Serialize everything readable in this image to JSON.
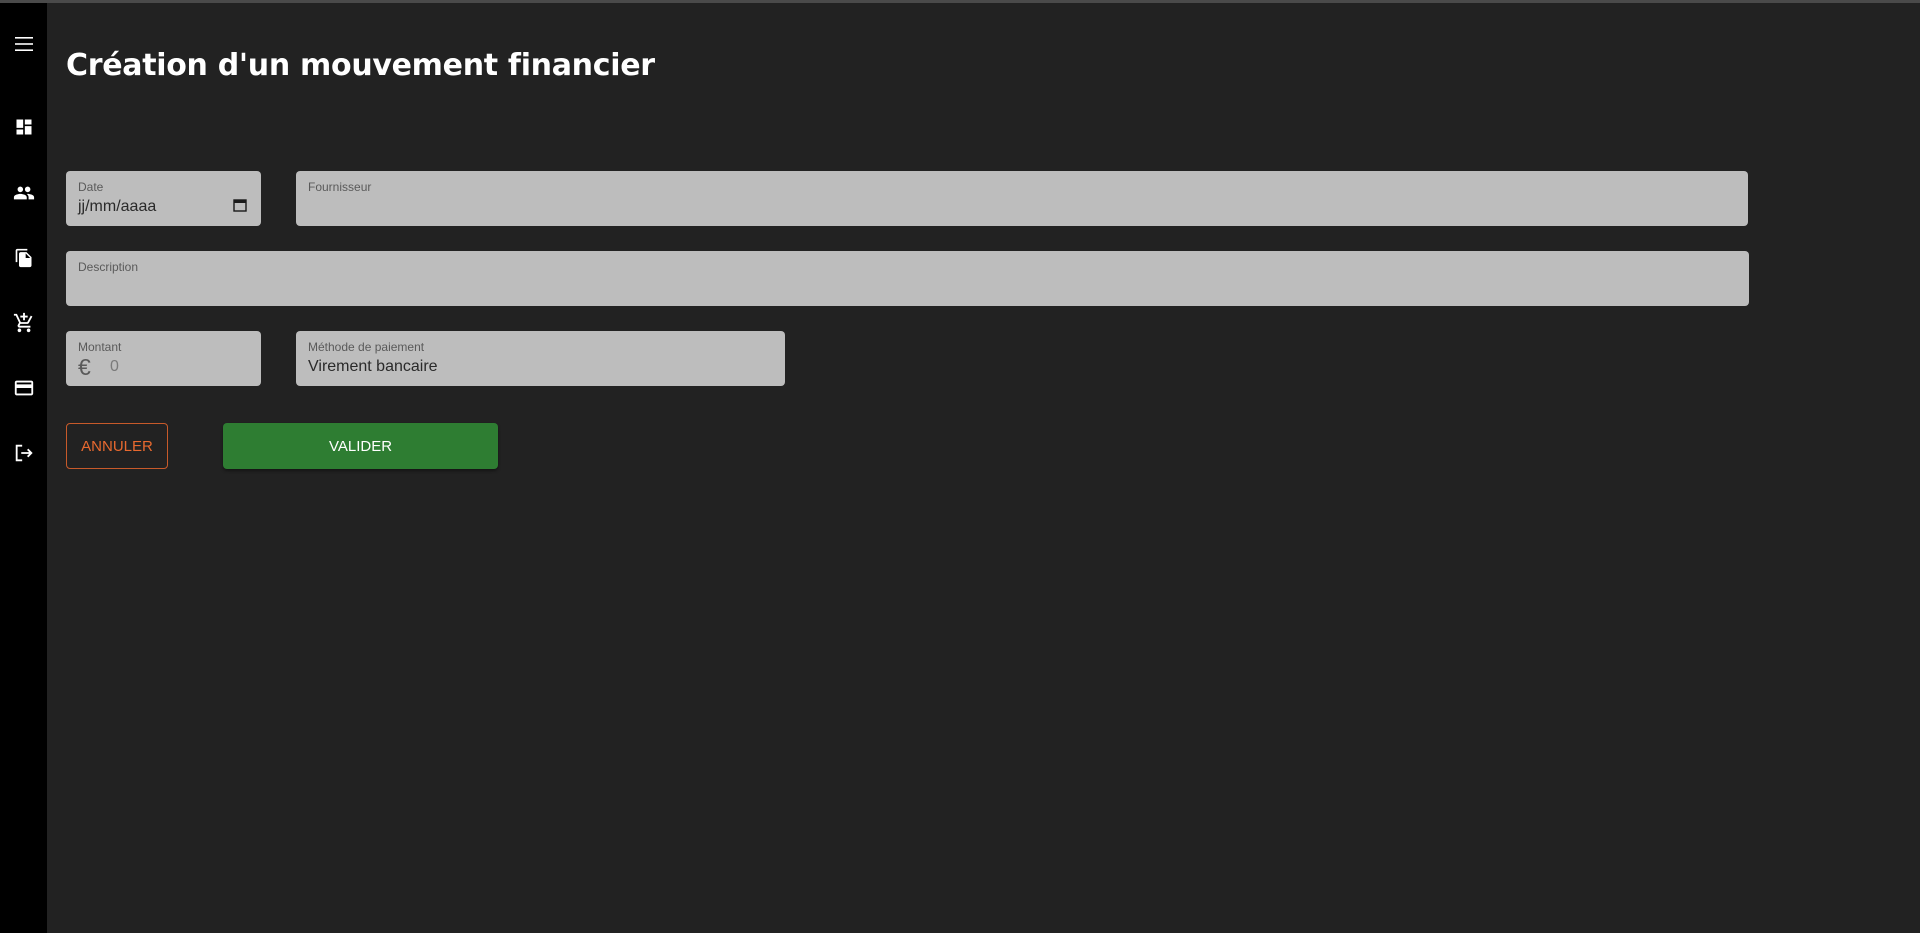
{
  "page": {
    "title": "Création d'un mouvement financier"
  },
  "sidebar": {
    "items": [
      {
        "icon": "menu-icon"
      },
      {
        "icon": "dashboard-icon"
      },
      {
        "icon": "people-icon"
      },
      {
        "icon": "documents-icon"
      },
      {
        "icon": "cart-icon"
      },
      {
        "icon": "credit-card-icon"
      },
      {
        "icon": "logout-icon"
      }
    ]
  },
  "form": {
    "date": {
      "label": "Date",
      "value": "jj/mm/aaaa"
    },
    "supplier": {
      "label": "Fournisseur",
      "value": ""
    },
    "description": {
      "label": "Description",
      "value": ""
    },
    "amount": {
      "label": "Montant",
      "currency": "€",
      "placeholder": "0"
    },
    "payment_method": {
      "label": "Méthode de paiement",
      "value": "Virement bancaire"
    }
  },
  "actions": {
    "cancel_label": "ANNULER",
    "submit_label": "VALIDER"
  },
  "colors": {
    "background": "#222222",
    "sidebar": "#000000",
    "field": "#bdbdbd",
    "cancel": "#e8692f",
    "submit": "#2e7d32"
  }
}
